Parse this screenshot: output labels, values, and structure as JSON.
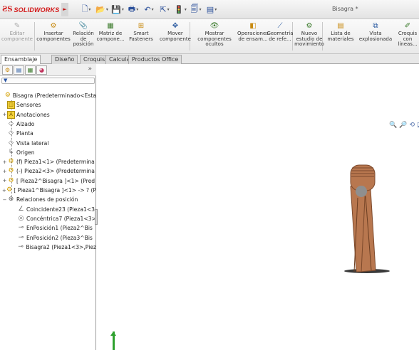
{
  "app": {
    "logo": "SOLIDWORKS",
    "document_title": "Bisagra *"
  },
  "quick_access": [
    {
      "icon": "new-document-icon",
      "glyph": "🗋"
    },
    {
      "icon": "open-folder-icon",
      "glyph": "📂"
    },
    {
      "icon": "save-icon",
      "glyph": "💾"
    },
    {
      "icon": "print-icon",
      "glyph": "🖶"
    },
    {
      "icon": "undo-icon",
      "glyph": "↶"
    },
    {
      "icon": "select-icon",
      "glyph": "⇱"
    },
    {
      "icon": "rebuild-icon",
      "glyph": "🚦"
    },
    {
      "icon": "file-properties-icon",
      "glyph": "🗐"
    },
    {
      "icon": "options-icon",
      "glyph": "▤"
    }
  ],
  "ribbon": {
    "commands": [
      {
        "label": "Editar\ncomponente",
        "icon": "edit-component-icon",
        "glyph": "✎",
        "disabled": true
      },
      {
        "label": "Insertar\ncomponentes",
        "icon": "insert-components-icon",
        "glyph": "⚙"
      },
      {
        "label": "Relación\nde\nposición",
        "icon": "mate-icon",
        "glyph": "📎"
      },
      {
        "label": "Matriz de\ncompone...",
        "icon": "component-pattern-icon",
        "glyph": "▦"
      },
      {
        "label": "Smart\nFasteners",
        "icon": "smart-fasteners-icon",
        "glyph": "⊞"
      },
      {
        "label": "Mover\ncomponente",
        "icon": "move-component-icon",
        "glyph": "✥"
      },
      {
        "label": "Mostrar\ncomponentes\nocultos",
        "icon": "show-hidden-icon",
        "glyph": "👁"
      },
      {
        "label": "Operaciones\nde ensam...",
        "icon": "assembly-features-icon",
        "glyph": "◧"
      },
      {
        "label": "Geometría\nde refe...",
        "icon": "reference-geometry-icon",
        "glyph": "⟋"
      },
      {
        "label": "Nuevo\nestudio de\nmovimiento",
        "icon": "motion-study-icon",
        "glyph": "⚙"
      },
      {
        "label": "Lista de\nmateriales",
        "icon": "bill-of-materials-icon",
        "glyph": "▤"
      },
      {
        "label": "Vista\nexplosionada",
        "icon": "exploded-view-icon",
        "glyph": "⧉"
      },
      {
        "label": "Croquis\ncon\nlíneas...",
        "icon": "explode-line-sketch-icon",
        "glyph": "✐"
      }
    ]
  },
  "tabs": [
    "Ensamblaje",
    "Diseño",
    "Croquis",
    "Calcula",
    "Productos Office"
  ],
  "active_tab": "Ensamblaje",
  "feature_manager": {
    "panel_tabs": [
      {
        "icon": "featuremanager-tree-icon",
        "glyph": "⚙"
      },
      {
        "icon": "property-manager-icon",
        "glyph": "▤"
      },
      {
        "icon": "configuration-manager-icon",
        "glyph": "▦"
      },
      {
        "icon": "display-manager-icon",
        "glyph": "◕"
      }
    ],
    "filter_glyph": "▼",
    "tree": [
      {
        "label": "Bisagra  (Predeterminado<Esta",
        "icon": "assembly-icon",
        "glyph": "⚙",
        "level": 0,
        "expander": ""
      },
      {
        "label": "Sensores",
        "icon": "sensors-folder-icon",
        "glyph": "◫",
        "level": 1,
        "expander": ""
      },
      {
        "label": "Anotaciones",
        "icon": "annotations-icon",
        "glyph": "A",
        "level": 1,
        "expander": "+"
      },
      {
        "label": "Alzado",
        "icon": "plane-icon",
        "glyph": "◇",
        "level": 1,
        "expander": ""
      },
      {
        "label": "Planta",
        "icon": "plane-icon",
        "glyph": "◇",
        "level": 1,
        "expander": ""
      },
      {
        "label": "Vista lateral",
        "icon": "plane-icon",
        "glyph": "◇",
        "level": 1,
        "expander": ""
      },
      {
        "label": "Origen",
        "icon": "origin-icon",
        "glyph": "↳",
        "level": 1,
        "expander": ""
      },
      {
        "label": "(f) Pieza1<1> (Predetermina",
        "icon": "part-icon",
        "glyph": "⚙",
        "level": 1,
        "expander": "+"
      },
      {
        "label": "(-) Pieza2<3> (Predetermina",
        "icon": "part-icon",
        "glyph": "⚙",
        "level": 1,
        "expander": "+"
      },
      {
        "label": "[ Pieza2^Bisagra ]<1> (Pred",
        "icon": "part-icon",
        "glyph": "⚙",
        "level": 1,
        "expander": "+"
      },
      {
        "label": "[ Pieza1^Bisagra ]<1> -> ? (P",
        "icon": "part-icon",
        "glyph": "⚙",
        "level": 1,
        "expander": "+"
      },
      {
        "label": "Relaciones de posición",
        "icon": "mates-folder-icon",
        "glyph": "⊕",
        "level": 1,
        "expander": "−"
      },
      {
        "label": "Coincidente23 (Pieza1<3",
        "icon": "coincident-mate-icon",
        "glyph": "∠",
        "level": 2,
        "expander": ""
      },
      {
        "label": "Concéntrica7 (Pieza1<3>",
        "icon": "concentric-mate-icon",
        "glyph": "◎",
        "level": 2,
        "expander": ""
      },
      {
        "label": "EnPosición1 (Pieza2^Bis",
        "icon": "lock-mate-icon",
        "glyph": "⊸",
        "level": 2,
        "expander": ""
      },
      {
        "label": "EnPosición2 (Pieza3^Bis",
        "icon": "lock-mate-icon",
        "glyph": "⊸",
        "level": 2,
        "expander": ""
      },
      {
        "label": "Bisagra2 (Pieza1<3>,Piez",
        "icon": "hinge-mate-icon",
        "glyph": "⊸",
        "level": 2,
        "expander": ""
      }
    ]
  },
  "heads_up_toolbar": [
    {
      "icon": "zoom-to-fit-icon",
      "glyph": "🔍"
    },
    {
      "icon": "zoom-area-icon",
      "glyph": "🔎"
    },
    {
      "icon": "previous-view-icon",
      "glyph": "⟲"
    },
    {
      "icon": "section-view-icon",
      "glyph": "◪"
    },
    {
      "icon": "view-orientation-icon",
      "glyph": "▣"
    },
    {
      "icon": "display-style-icon",
      "glyph": "◧"
    },
    {
      "icon": "hide-show-icon",
      "glyph": "◔"
    },
    {
      "icon": "appearance-icon",
      "glyph": "●"
    },
    {
      "icon": "scene-icon",
      "glyph": "◍"
    },
    {
      "icon": "view-settings-icon",
      "glyph": "▭"
    }
  ],
  "colors": {
    "accent": "#d31818",
    "part_body": "#b8774f",
    "part_shadow": "#3a3a3a",
    "pin": "#8f8f8f",
    "triad_green": "#2ea12e"
  }
}
